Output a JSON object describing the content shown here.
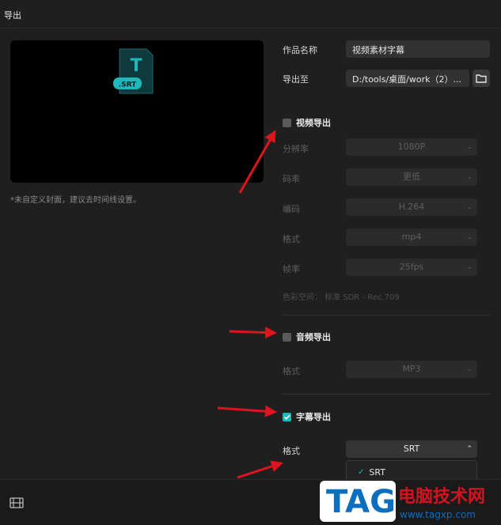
{
  "window": {
    "title": "导出"
  },
  "preview": {
    "file_badge": ".SRT",
    "icon_letter": "T",
    "note": "*未自定义封面，建议去时间线设置。"
  },
  "fields": {
    "name_label": "作品名称",
    "name_value": "视频素材字幕",
    "export_to_label": "导出至",
    "export_path": "D:/tools/桌面/work（2）..."
  },
  "video_export": {
    "label": "视频导出",
    "checked": false,
    "rows": [
      {
        "label": "分辨率",
        "value": "1080P"
      },
      {
        "label": "码率",
        "value": "更低"
      },
      {
        "label": "编码",
        "value": "H.264"
      },
      {
        "label": "格式",
        "value": "mp4"
      },
      {
        "label": "帧率",
        "value": "25fps"
      }
    ],
    "color_space": "色彩空间：  标准 SDR - Rec.709"
  },
  "audio_export": {
    "label": "音频导出",
    "checked": false,
    "format_label": "格式",
    "format_value": "MP3"
  },
  "subtitle_export": {
    "label": "字幕导出",
    "checked": true,
    "format_label": "格式",
    "format_value": "SRT",
    "dropdown_options": [
      "SRT"
    ]
  },
  "watermark": {
    "tag": "TAG",
    "title": "电脑技术网",
    "url": "www.tagxp.com"
  },
  "colors": {
    "accent": "#1fb9bd",
    "arrow": "#e0141e",
    "background": "#1f1f1f"
  },
  "icons": [
    "srt-file-icon",
    "folder-icon",
    "checkbox-icon",
    "chevron-down-icon",
    "chevron-up-icon",
    "check-icon",
    "film-icon"
  ]
}
